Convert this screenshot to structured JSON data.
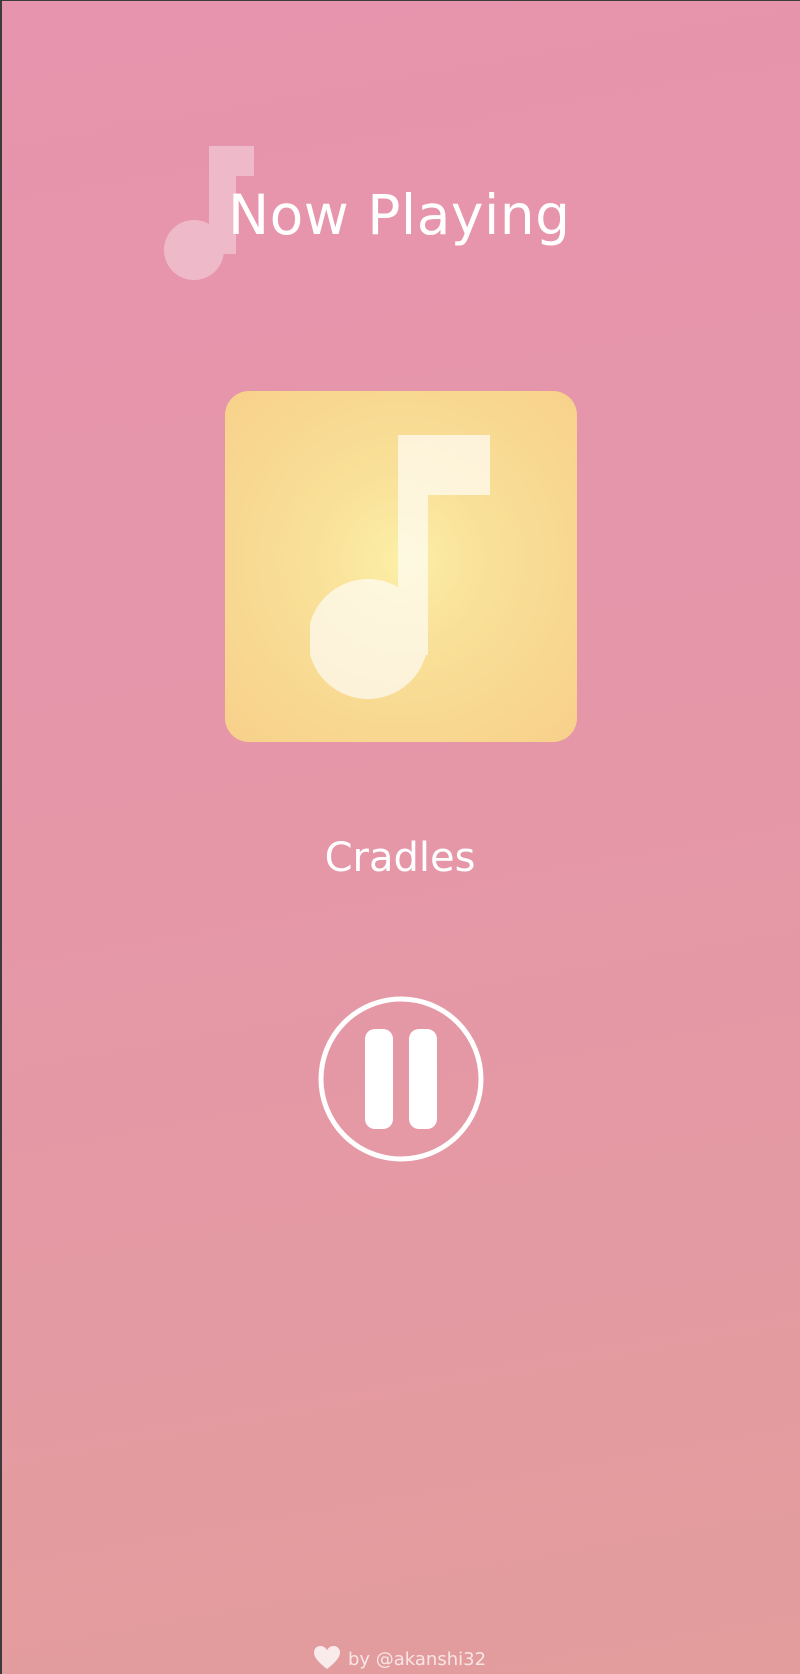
{
  "header": {
    "title": "Now Playing",
    "icon": "music-note-icon"
  },
  "album": {
    "icon": "music-note-icon",
    "colors": {
      "center": "#fcefa6",
      "edge": "#f7d08a"
    }
  },
  "track": {
    "title": "Cradles"
  },
  "controls": {
    "pause_icon": "pause-icon"
  },
  "footer": {
    "icon": "heart-icon",
    "credit": "by @akanshi32"
  },
  "colors": {
    "background_top": "#e794ae",
    "background_bottom": "#e39d9c",
    "foreground": "#ffffff"
  }
}
